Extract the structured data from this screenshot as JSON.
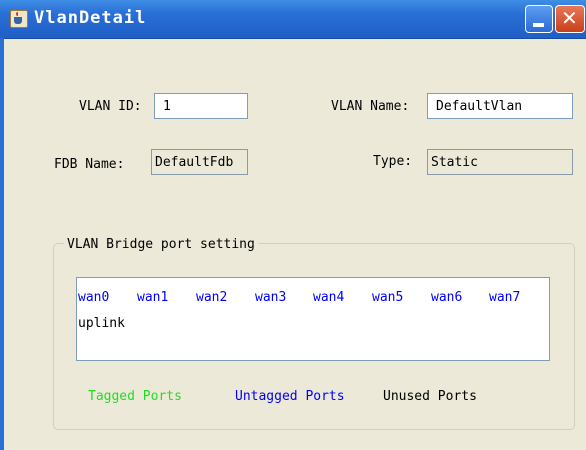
{
  "window": {
    "title": "VlanDetail"
  },
  "form": {
    "vlan_id_label": "VLAN ID:",
    "vlan_id_value": "1",
    "vlan_name_label": "VLAN Name:",
    "vlan_name_value": "DefaultVlan",
    "fdb_name_label": "FDB Name:",
    "fdb_name_value": "DefaultFdb",
    "type_label": "Type:",
    "type_value": "Static"
  },
  "bridge": {
    "group_title": "VLAN Bridge port setting",
    "ports": [
      {
        "label": "wan0",
        "state": "untagged"
      },
      {
        "label": "wan1",
        "state": "untagged"
      },
      {
        "label": "wan2",
        "state": "untagged"
      },
      {
        "label": "wan3",
        "state": "untagged"
      },
      {
        "label": "wan4",
        "state": "untagged"
      },
      {
        "label": "wan5",
        "state": "untagged"
      },
      {
        "label": "wan6",
        "state": "untagged"
      },
      {
        "label": "wan7",
        "state": "untagged"
      },
      {
        "label": "uplink",
        "state": "unused"
      }
    ],
    "legend": {
      "tagged": "Tagged Ports",
      "untagged": "Untagged Ports",
      "unused": "Unused Ports"
    }
  },
  "colors": {
    "tagged": "#22dd22",
    "untagged": "#0000ff",
    "unused": "#000000",
    "titlebar": "#2a6fd6"
  }
}
